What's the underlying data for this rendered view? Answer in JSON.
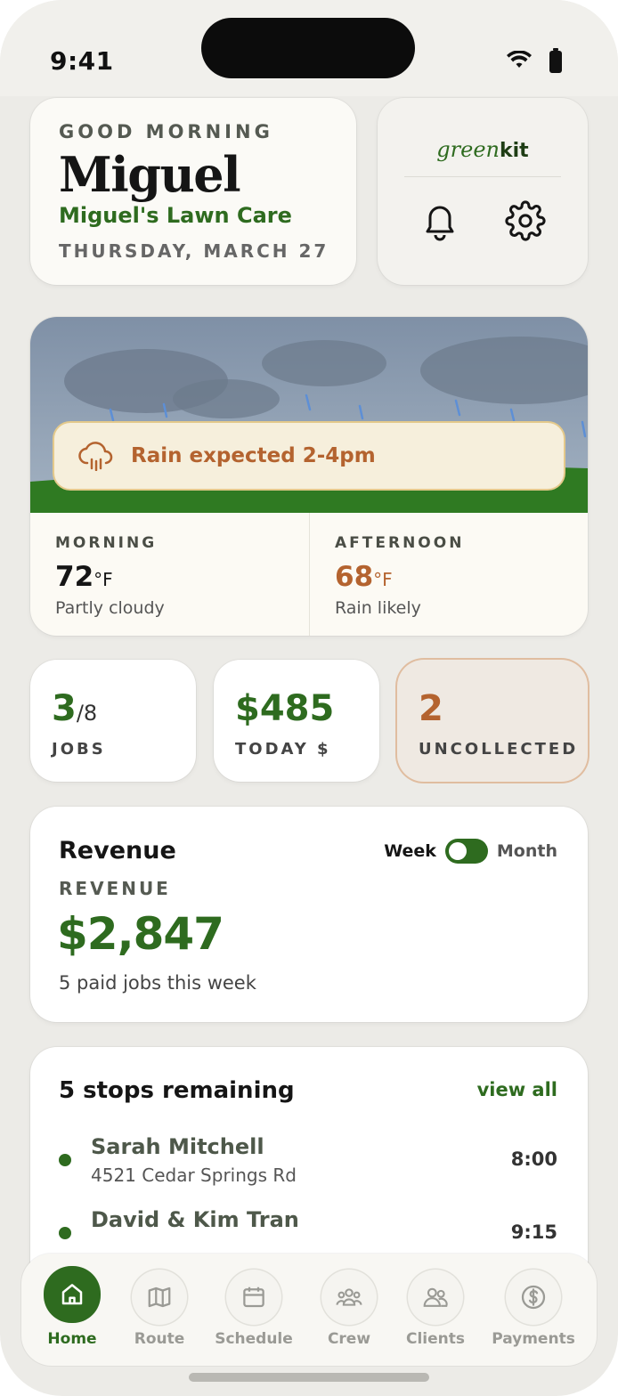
{
  "status_bar": {
    "time": "9:41"
  },
  "greeting": {
    "eyebrow": "GOOD MORNING",
    "name": "Miguel",
    "business": "Miguel's Lawn Care",
    "date": "THURSDAY, MARCH 27"
  },
  "brand": {
    "logo_italic": "green",
    "logo_bold": "kit",
    "notifications_icon": "bell-icon",
    "settings_icon": "gear-icon"
  },
  "weather": {
    "alert": "Rain expected 2-4pm",
    "alert_icon": "cloud-rain-icon",
    "morning": {
      "label": "MORNING",
      "temp": "72",
      "unit": "°F",
      "desc": "Partly cloudy"
    },
    "afternoon": {
      "label": "AFTERNOON",
      "temp": "68",
      "unit": "°F",
      "desc": "Rain likely"
    }
  },
  "stats": {
    "jobs": {
      "value": "3",
      "total": "/8",
      "label": "JOBS"
    },
    "today": {
      "value": "$485",
      "label": "TODAY $"
    },
    "uncollected": {
      "value": "2",
      "label": "UNCOLLECTED"
    }
  },
  "revenue": {
    "title": "Revenue",
    "toggle_left": "Week",
    "toggle_right": "Month",
    "toggle_state": "week",
    "eyebrow": "REVENUE",
    "amount": "$2,847",
    "subtitle": "5 paid jobs this week"
  },
  "stops": {
    "title": "5 stops remaining",
    "view_all": "view all",
    "items": [
      {
        "name": "Sarah Mitchell",
        "address": "4521 Cedar Springs Rd",
        "time": "8:00"
      },
      {
        "name": "David & Kim Tran",
        "address": "",
        "time": "9:15"
      }
    ]
  },
  "nav": {
    "items": [
      {
        "label": "Home",
        "icon": "home-icon",
        "active": true
      },
      {
        "label": "Route",
        "icon": "map-icon"
      },
      {
        "label": "Schedule",
        "icon": "calendar-icon"
      },
      {
        "label": "Crew",
        "icon": "crew-icon"
      },
      {
        "label": "Clients",
        "icon": "clients-icon"
      },
      {
        "label": "Payments",
        "icon": "dollar-icon"
      }
    ]
  },
  "colors": {
    "brand_green": "#2e6b1f",
    "warning_orange": "#b4632f",
    "background": "#ecebe7"
  }
}
